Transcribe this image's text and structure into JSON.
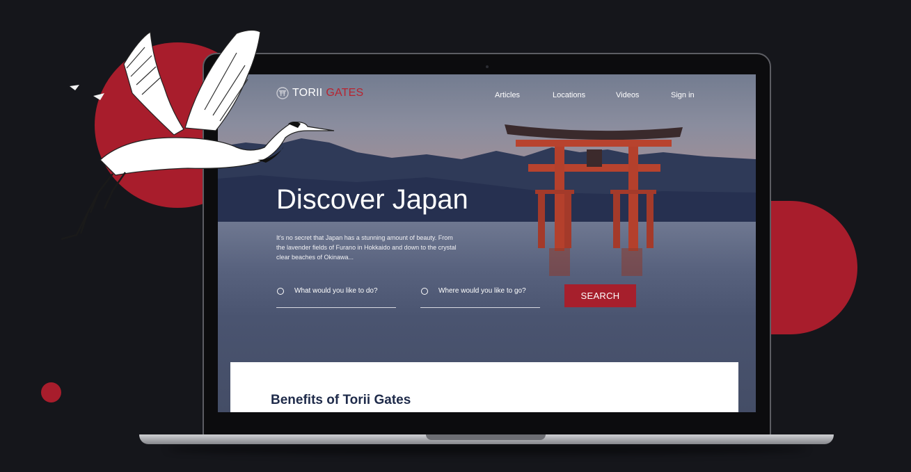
{
  "site": {
    "logo_primary": "TORII",
    "logo_accent": "GATES"
  },
  "nav": {
    "items": [
      "Articles",
      "Locations",
      "Videos",
      "Sign in"
    ]
  },
  "hero": {
    "title": "Discover Japan",
    "body": "It's no secret that Japan has a stunning amount of beauty. From the lavender fields of Furano in Hokkaido and down to the crystal clear beaches of Okinawa..."
  },
  "search": {
    "what_placeholder": "What would you like to do?",
    "where_placeholder": "Where would you like to go?",
    "button_label": "SEARCH"
  },
  "benefits": {
    "title": "Benefits of Torii Gates"
  },
  "colors": {
    "accent": "#a81d2c",
    "background": "#15161b"
  },
  "icons": [
    "torii-gate-icon",
    "radio-icon",
    "crane-illustration"
  ]
}
